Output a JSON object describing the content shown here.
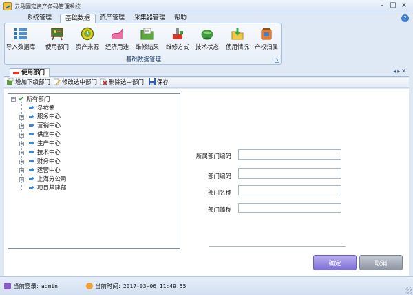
{
  "window": {
    "title": "云马固定资产条码管理系统",
    "controls": {
      "minimize": "–",
      "maximize": "□",
      "close": "×"
    }
  },
  "menu": {
    "tabs": [
      {
        "label": "系统管理"
      },
      {
        "label": "基础数据",
        "active": true
      },
      {
        "label": "资产管理"
      },
      {
        "label": "采集器管理"
      },
      {
        "label": "帮助"
      }
    ],
    "help_icon": "?"
  },
  "ribbon": {
    "group_label": "基础数据管理",
    "buttons": [
      {
        "label": "导入数据库",
        "icon": "database-list-icon"
      },
      {
        "label": "使用部门",
        "icon": "department-board-icon"
      },
      {
        "label": "资产来源",
        "icon": "source-clock-icon"
      },
      {
        "label": "经济用途",
        "icon": "usage-chart-icon"
      },
      {
        "label": "维修结果",
        "icon": "repair-folder-icon"
      },
      {
        "label": "维修方式",
        "icon": "repair-tool-icon"
      },
      {
        "label": "技术状态",
        "icon": "status-globe-icon"
      },
      {
        "label": "使用情况",
        "icon": "usage-download-icon"
      },
      {
        "label": "产权归属",
        "icon": "ownership-jar-icon"
      }
    ]
  },
  "doc_tab": {
    "label": "使用部门"
  },
  "toolbar": {
    "add_label": "增加下级部门",
    "edit_label": "修改选中部门",
    "delete_label": "删除选中部门",
    "save_label": "保存"
  },
  "tree": {
    "root": "所有部门",
    "items": [
      {
        "label": "总裁会",
        "expandable": false
      },
      {
        "label": "服务中心",
        "expandable": true
      },
      {
        "label": "营销中心",
        "expandable": true
      },
      {
        "label": "供应中心",
        "expandable": true
      },
      {
        "label": "生产中心",
        "expandable": true
      },
      {
        "label": "技术中心",
        "expandable": true
      },
      {
        "label": "财务中心",
        "expandable": true
      },
      {
        "label": "运营中心",
        "expandable": true
      },
      {
        "label": "上海分公司",
        "expandable": true
      },
      {
        "label": "项目基建部",
        "expandable": false
      }
    ]
  },
  "form": {
    "parent_code_label": "所属部门编码",
    "parent_code_value": "",
    "code_label": "部门编码",
    "code_value": "",
    "name_label": "部门名称",
    "name_value": "",
    "short_name_label": "部门简称",
    "short_name_value": "",
    "ok_label": "确定",
    "cancel_label": "取消"
  },
  "status": {
    "login_label": "当前登录:",
    "login_value": "admin",
    "time_label": "当前时间:",
    "time_value": "2017-03-06 11:49:55"
  },
  "colors": {
    "ok_button": "#8a7ce0",
    "cancel_button": "#9aa2b0",
    "tree_check": "#2b8a2b",
    "tree_arrow": "#3b86d8"
  }
}
